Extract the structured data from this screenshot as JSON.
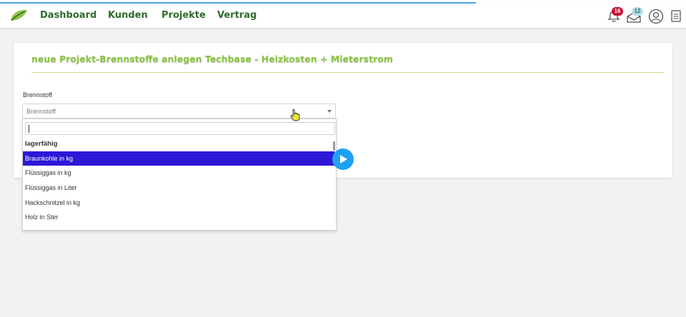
{
  "nav": {
    "links": [
      "Dashboard",
      "Kunden",
      "Projekte",
      "Vertrag"
    ],
    "notifications_count": "16",
    "messages_count": "12"
  },
  "card": {
    "title": "neue Projekt-Brennstoffe anlegen Techbase - Heizkosten + Mieterstrom"
  },
  "field": {
    "label": "Brennstoff",
    "placeholder": "Brennstoff"
  },
  "dropdown": {
    "search_value": "",
    "group": "lagerfähig",
    "options": [
      "Braunkohle in kg",
      "Flüssiggas in kg",
      "Flüssiggas in Liter",
      "Hackschnitzel in kg",
      "Holz in Ster"
    ],
    "selected_index": 0
  },
  "colors": {
    "nav_text": "#2e6b2a",
    "title": "#8cc63f",
    "selected_option": "#2d17d6",
    "play_button": "#1da1f2",
    "badge_red": "#c8102e"
  }
}
